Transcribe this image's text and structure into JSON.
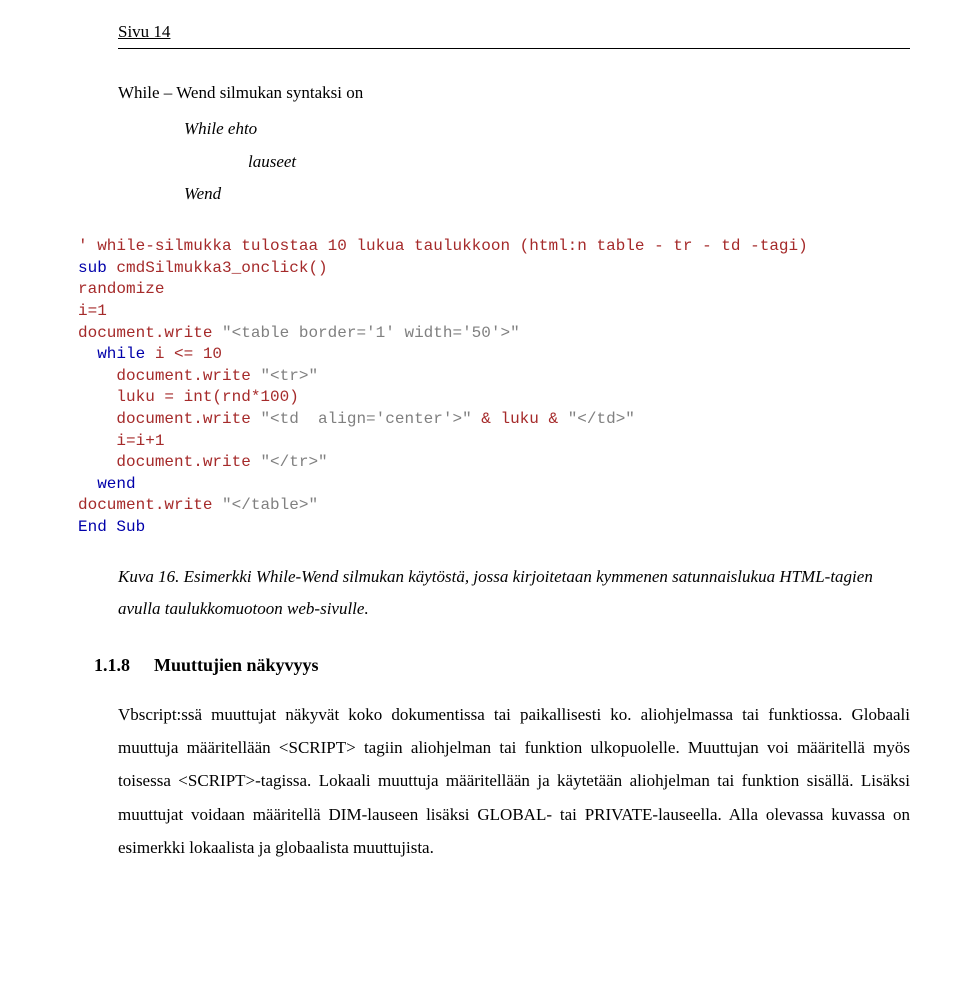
{
  "header": {
    "page_label": "Sivu 14"
  },
  "intro": {
    "text": "While – Wend silmukan syntaksi on"
  },
  "syntax": {
    "line1": "While ehto",
    "line2": "lauseet",
    "line3": "Wend"
  },
  "code": {
    "l1_a": "' while-silmukka tulostaa 10 lukua taulukkoon (html:n table - tr - td -tagi)",
    "l2_kw": "sub",
    "l2_b": " cmdSilmukka3_onclick()",
    "l3": "randomize",
    "l4": "i=1",
    "l5_a": "document.write ",
    "l5_str": "\"<table border='1' width='50'>\"",
    "l6_pad": "  ",
    "l6_kw": "while",
    "l6_b": " i <= 10",
    "l7_a": "    document.write ",
    "l7_str": "\"<tr>\"",
    "l8_a": "    luku = int(rnd*100)",
    "l9_a": "    document.write ",
    "l9_str1": "\"<td  align='center'>\"",
    "l9_b": " & luku & ",
    "l9_str2": "\"</td>\"",
    "l10": "    i=i+1",
    "l11_a": "    document.write ",
    "l11_str": "\"</tr>\"",
    "l12_pad": "  ",
    "l12_kw": "wend",
    "l13_a": "document.write ",
    "l13_str": "\"</table>\"",
    "l14_kw": "End Sub"
  },
  "caption": {
    "label": "Kuva 16.",
    "text": " Esimerkki While-Wend silmukan käytöstä, jossa kirjoitetaan kymmenen satunnaislukua HTML-tagien avulla taulukkomuotoon web-sivulle."
  },
  "section": {
    "number": "1.1.8",
    "title": "Muuttujien näkyvyys"
  },
  "paragraph": {
    "text": "Vbscript:ssä muuttujat näkyvät koko dokumentissa tai paikallisesti ko. aliohjelmassa tai funktiossa. Globaali muuttuja määritellään <SCRIPT> tagiin aliohjelman tai funktion ulkopuolelle. Muuttujan voi määritellä myös toisessa <SCRIPT>-tagissa. Lokaali muuttuja määritellään ja käytetään aliohjelman tai funktion sisällä. Lisäksi muuttujat voidaan määritellä DIM-lauseen lisäksi GLOBAL- tai PRIVATE-lauseella. Alla olevassa kuvassa on esimerkki lokaalista ja globaalista muuttujista."
  }
}
